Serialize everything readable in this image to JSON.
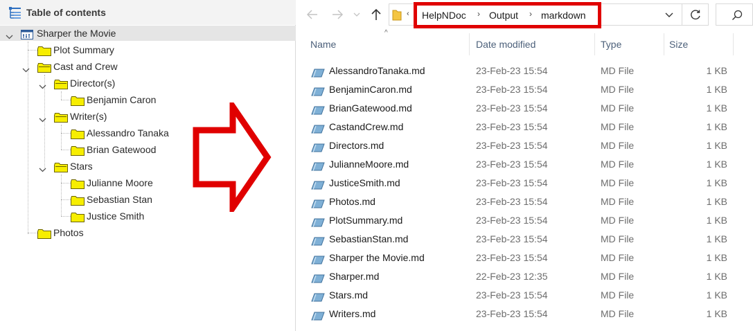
{
  "toc": {
    "title": "Table of contents",
    "items": [
      {
        "label": "Sharper the Movie",
        "icon": "project-icon",
        "expanded": true,
        "selected": true
      },
      {
        "label": "Plot Summary",
        "icon": "folder-icon"
      },
      {
        "label": "Cast and Crew",
        "icon": "folder-icon",
        "expanded": true
      },
      {
        "label": "Director(s)",
        "icon": "folder-icon",
        "expanded": true
      },
      {
        "label": "Benjamin Caron",
        "icon": "folder-icon"
      },
      {
        "label": "Writer(s)",
        "icon": "folder-icon",
        "expanded": true
      },
      {
        "label": "Alessandro Tanaka",
        "icon": "folder-icon"
      },
      {
        "label": "Brian Gatewood",
        "icon": "folder-icon"
      },
      {
        "label": "Stars",
        "icon": "folder-icon",
        "expanded": true
      },
      {
        "label": "Julianne Moore",
        "icon": "folder-icon"
      },
      {
        "label": "Sebastian Stan",
        "icon": "folder-icon"
      },
      {
        "label": "Justice Smith",
        "icon": "folder-icon"
      },
      {
        "label": "Photos",
        "icon": "folder-icon"
      }
    ]
  },
  "explorer": {
    "nav": {
      "back_icon": "arrow-left-icon",
      "forward_icon": "arrow-right-icon",
      "recent_icon": "chevron-down-icon",
      "up_icon": "arrow-up-icon",
      "refresh_icon": "refresh-icon",
      "search_icon": "search-icon"
    },
    "breadcrumb": [
      "HelpNDoc",
      "Output",
      "markdown"
    ],
    "columns": {
      "name": "Name",
      "date": "Date modified",
      "type": "Type",
      "size": "Size"
    },
    "files": [
      {
        "name": "AlessandroTanaka.md",
        "date": "23-Feb-23 15:54",
        "type": "MD File",
        "size": "1 KB"
      },
      {
        "name": "BenjaminCaron.md",
        "date": "23-Feb-23 15:54",
        "type": "MD File",
        "size": "1 KB"
      },
      {
        "name": "BrianGatewood.md",
        "date": "23-Feb-23 15:54",
        "type": "MD File",
        "size": "1 KB"
      },
      {
        "name": "CastandCrew.md",
        "date": "23-Feb-23 15:54",
        "type": "MD File",
        "size": "1 KB"
      },
      {
        "name": "Directors.md",
        "date": "23-Feb-23 15:54",
        "type": "MD File",
        "size": "1 KB"
      },
      {
        "name": "JulianneMoore.md",
        "date": "23-Feb-23 15:54",
        "type": "MD File",
        "size": "1 KB"
      },
      {
        "name": "JusticeSmith.md",
        "date": "23-Feb-23 15:54",
        "type": "MD File",
        "size": "1 KB"
      },
      {
        "name": "Photos.md",
        "date": "23-Feb-23 15:54",
        "type": "MD File",
        "size": "1 KB"
      },
      {
        "name": "PlotSummary.md",
        "date": "23-Feb-23 15:54",
        "type": "MD File",
        "size": "1 KB"
      },
      {
        "name": "SebastianStan.md",
        "date": "23-Feb-23 15:54",
        "type": "MD File",
        "size": "1 KB"
      },
      {
        "name": "Sharper the Movie.md",
        "date": "23-Feb-23 15:54",
        "type": "MD File",
        "size": "1 KB"
      },
      {
        "name": "Sharper.md",
        "date": "22-Feb-23 12:35",
        "type": "MD File",
        "size": "1 KB"
      },
      {
        "name": "Stars.md",
        "date": "23-Feb-23 15:54",
        "type": "MD File",
        "size": "1 KB"
      },
      {
        "name": "Writers.md",
        "date": "23-Feb-23 15:54",
        "type": "MD File",
        "size": "1 KB"
      }
    ]
  },
  "colors": {
    "highlight": "#e00000",
    "folder": "#f7ee00",
    "selected_row": "#e5e5e5",
    "header_text": "#4c607a"
  }
}
